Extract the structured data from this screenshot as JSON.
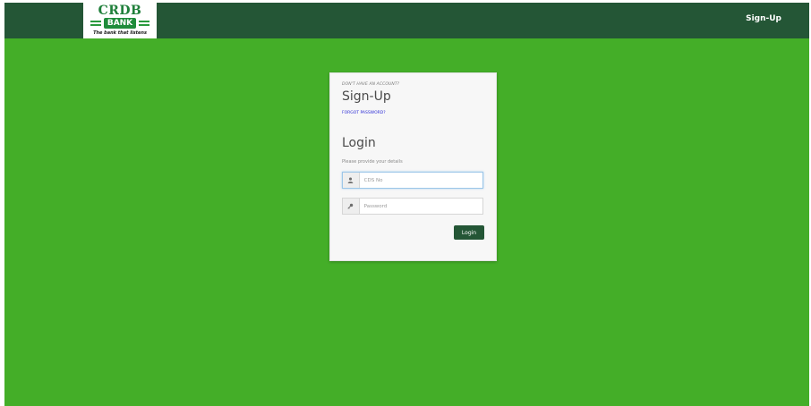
{
  "header": {
    "logo": {
      "brand": "CRDB",
      "bank": "BANK",
      "tagline": "The bank that listens"
    },
    "signup_link": "Sign-Up"
  },
  "card": {
    "eyebrow": "DON'T HAVE AN ACCOUNT?",
    "signup_title": "Sign-Up",
    "forgot_link": "FORGOT PASSWORD?",
    "login_title": "Login",
    "subtitle": "Please provide your details",
    "cds_field": {
      "placeholder": "CDS No",
      "value": "",
      "icon": "user-icon"
    },
    "password_field": {
      "placeholder": "Password",
      "value": "",
      "icon": "key-icon"
    },
    "login_button": "Login"
  },
  "colors": {
    "background": "#44ae28",
    "topbar": "#245636",
    "button": "#245636",
    "link": "#2b2bd6"
  }
}
